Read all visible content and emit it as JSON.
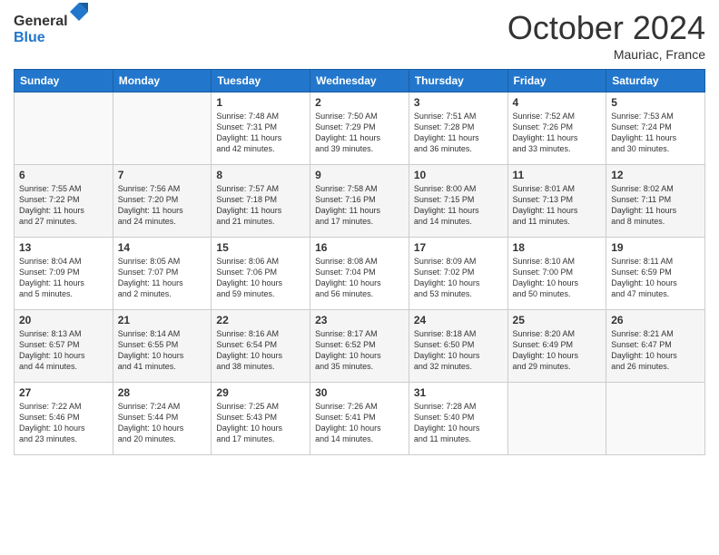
{
  "header": {
    "logo_general": "General",
    "logo_blue": "Blue",
    "title": "October 2024",
    "location": "Mauriac, France"
  },
  "columns": [
    "Sunday",
    "Monday",
    "Tuesday",
    "Wednesday",
    "Thursday",
    "Friday",
    "Saturday"
  ],
  "rows": [
    [
      {
        "day": "",
        "content": ""
      },
      {
        "day": "",
        "content": ""
      },
      {
        "day": "1",
        "content": "Sunrise: 7:48 AM\nSunset: 7:31 PM\nDaylight: 11 hours\nand 42 minutes."
      },
      {
        "day": "2",
        "content": "Sunrise: 7:50 AM\nSunset: 7:29 PM\nDaylight: 11 hours\nand 39 minutes."
      },
      {
        "day": "3",
        "content": "Sunrise: 7:51 AM\nSunset: 7:28 PM\nDaylight: 11 hours\nand 36 minutes."
      },
      {
        "day": "4",
        "content": "Sunrise: 7:52 AM\nSunset: 7:26 PM\nDaylight: 11 hours\nand 33 minutes."
      },
      {
        "day": "5",
        "content": "Sunrise: 7:53 AM\nSunset: 7:24 PM\nDaylight: 11 hours\nand 30 minutes."
      }
    ],
    [
      {
        "day": "6",
        "content": "Sunrise: 7:55 AM\nSunset: 7:22 PM\nDaylight: 11 hours\nand 27 minutes."
      },
      {
        "day": "7",
        "content": "Sunrise: 7:56 AM\nSunset: 7:20 PM\nDaylight: 11 hours\nand 24 minutes."
      },
      {
        "day": "8",
        "content": "Sunrise: 7:57 AM\nSunset: 7:18 PM\nDaylight: 11 hours\nand 21 minutes."
      },
      {
        "day": "9",
        "content": "Sunrise: 7:58 AM\nSunset: 7:16 PM\nDaylight: 11 hours\nand 17 minutes."
      },
      {
        "day": "10",
        "content": "Sunrise: 8:00 AM\nSunset: 7:15 PM\nDaylight: 11 hours\nand 14 minutes."
      },
      {
        "day": "11",
        "content": "Sunrise: 8:01 AM\nSunset: 7:13 PM\nDaylight: 11 hours\nand 11 minutes."
      },
      {
        "day": "12",
        "content": "Sunrise: 8:02 AM\nSunset: 7:11 PM\nDaylight: 11 hours\nand 8 minutes."
      }
    ],
    [
      {
        "day": "13",
        "content": "Sunrise: 8:04 AM\nSunset: 7:09 PM\nDaylight: 11 hours\nand 5 minutes."
      },
      {
        "day": "14",
        "content": "Sunrise: 8:05 AM\nSunset: 7:07 PM\nDaylight: 11 hours\nand 2 minutes."
      },
      {
        "day": "15",
        "content": "Sunrise: 8:06 AM\nSunset: 7:06 PM\nDaylight: 10 hours\nand 59 minutes."
      },
      {
        "day": "16",
        "content": "Sunrise: 8:08 AM\nSunset: 7:04 PM\nDaylight: 10 hours\nand 56 minutes."
      },
      {
        "day": "17",
        "content": "Sunrise: 8:09 AM\nSunset: 7:02 PM\nDaylight: 10 hours\nand 53 minutes."
      },
      {
        "day": "18",
        "content": "Sunrise: 8:10 AM\nSunset: 7:00 PM\nDaylight: 10 hours\nand 50 minutes."
      },
      {
        "day": "19",
        "content": "Sunrise: 8:11 AM\nSunset: 6:59 PM\nDaylight: 10 hours\nand 47 minutes."
      }
    ],
    [
      {
        "day": "20",
        "content": "Sunrise: 8:13 AM\nSunset: 6:57 PM\nDaylight: 10 hours\nand 44 minutes."
      },
      {
        "day": "21",
        "content": "Sunrise: 8:14 AM\nSunset: 6:55 PM\nDaylight: 10 hours\nand 41 minutes."
      },
      {
        "day": "22",
        "content": "Sunrise: 8:16 AM\nSunset: 6:54 PM\nDaylight: 10 hours\nand 38 minutes."
      },
      {
        "day": "23",
        "content": "Sunrise: 8:17 AM\nSunset: 6:52 PM\nDaylight: 10 hours\nand 35 minutes."
      },
      {
        "day": "24",
        "content": "Sunrise: 8:18 AM\nSunset: 6:50 PM\nDaylight: 10 hours\nand 32 minutes."
      },
      {
        "day": "25",
        "content": "Sunrise: 8:20 AM\nSunset: 6:49 PM\nDaylight: 10 hours\nand 29 minutes."
      },
      {
        "day": "26",
        "content": "Sunrise: 8:21 AM\nSunset: 6:47 PM\nDaylight: 10 hours\nand 26 minutes."
      }
    ],
    [
      {
        "day": "27",
        "content": "Sunrise: 7:22 AM\nSunset: 5:46 PM\nDaylight: 10 hours\nand 23 minutes."
      },
      {
        "day": "28",
        "content": "Sunrise: 7:24 AM\nSunset: 5:44 PM\nDaylight: 10 hours\nand 20 minutes."
      },
      {
        "day": "29",
        "content": "Sunrise: 7:25 AM\nSunset: 5:43 PM\nDaylight: 10 hours\nand 17 minutes."
      },
      {
        "day": "30",
        "content": "Sunrise: 7:26 AM\nSunset: 5:41 PM\nDaylight: 10 hours\nand 14 minutes."
      },
      {
        "day": "31",
        "content": "Sunrise: 7:28 AM\nSunset: 5:40 PM\nDaylight: 10 hours\nand 11 minutes."
      },
      {
        "day": "",
        "content": ""
      },
      {
        "day": "",
        "content": ""
      }
    ]
  ]
}
